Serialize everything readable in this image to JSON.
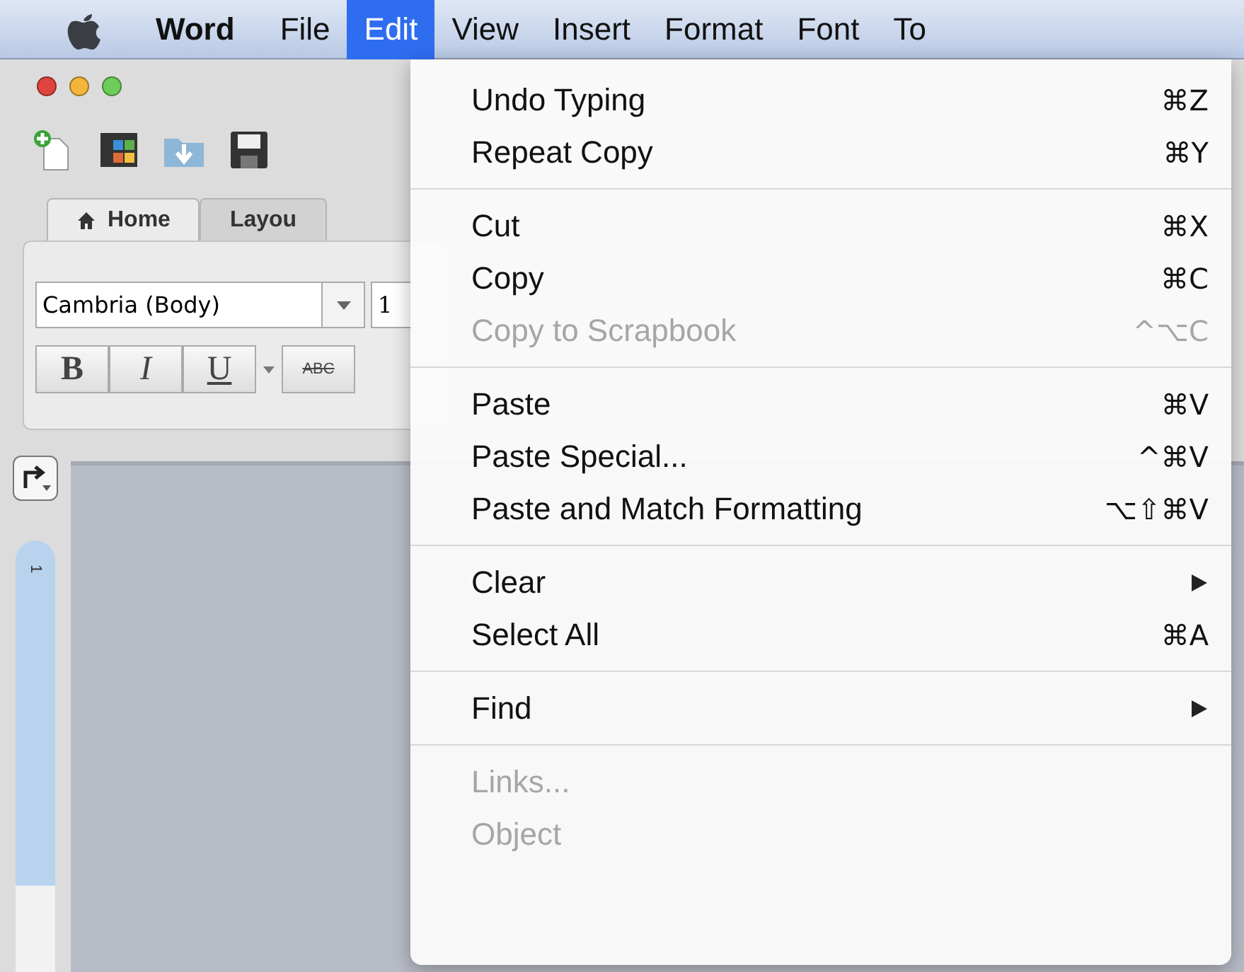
{
  "menu_bar": {
    "items": [
      {
        "label": "Word",
        "kind": "app",
        "selected": false
      },
      {
        "label": "File",
        "kind": "menu",
        "selected": false
      },
      {
        "label": "Edit",
        "kind": "menu",
        "selected": true
      },
      {
        "label": "View",
        "kind": "menu",
        "selected": false
      },
      {
        "label": "Insert",
        "kind": "menu",
        "selected": false
      },
      {
        "label": "Format",
        "kind": "menu",
        "selected": false
      },
      {
        "label": "Font",
        "kind": "menu",
        "selected": false
      },
      {
        "label": "To",
        "kind": "menu",
        "selected": false
      }
    ]
  },
  "window": {
    "tabs": [
      {
        "label": "Home",
        "selected": true
      },
      {
        "label": "Layou",
        "selected": false
      }
    ],
    "font_field": {
      "value": "Cambria (Body)"
    },
    "size_field": {
      "value": "1"
    },
    "format_buttons": [
      {
        "label": "B",
        "kind": "bold"
      },
      {
        "label": "I",
        "kind": "italic"
      },
      {
        "label": "U",
        "kind": "underline"
      },
      {
        "label": "ABC",
        "kind": "strikethrough"
      }
    ],
    "ruler": {
      "label": "1"
    }
  },
  "edit_menu": {
    "groups": [
      [
        {
          "label": "Undo Typing",
          "shortcut": "⌘Z",
          "disabled": false,
          "submenu": false
        },
        {
          "label": "Repeat Copy",
          "shortcut": "⌘Y",
          "disabled": false,
          "submenu": false
        }
      ],
      [
        {
          "label": "Cut",
          "shortcut": "⌘X",
          "disabled": false,
          "submenu": false
        },
        {
          "label": "Copy",
          "shortcut": "⌘C",
          "disabled": false,
          "submenu": false
        },
        {
          "label": "Copy to Scrapbook",
          "shortcut": "^⌥C",
          "disabled": true,
          "submenu": false
        }
      ],
      [
        {
          "label": "Paste",
          "shortcut": "⌘V",
          "disabled": false,
          "submenu": false
        },
        {
          "label": "Paste Special...",
          "shortcut": "^⌘V",
          "disabled": false,
          "submenu": false
        },
        {
          "label": "Paste and Match Formatting",
          "shortcut": "⌥⇧⌘V",
          "disabled": false,
          "submenu": false
        }
      ],
      [
        {
          "label": "Clear",
          "disabled": false,
          "submenu": true
        },
        {
          "label": "Select All",
          "shortcut": "⌘A",
          "disabled": false,
          "submenu": false
        }
      ],
      [
        {
          "label": "Find",
          "disabled": false,
          "submenu": true
        }
      ],
      [
        {
          "label": "Links...",
          "disabled": true,
          "submenu": false
        },
        {
          "label": "Object",
          "disabled": true,
          "submenu": false
        }
      ]
    ]
  }
}
